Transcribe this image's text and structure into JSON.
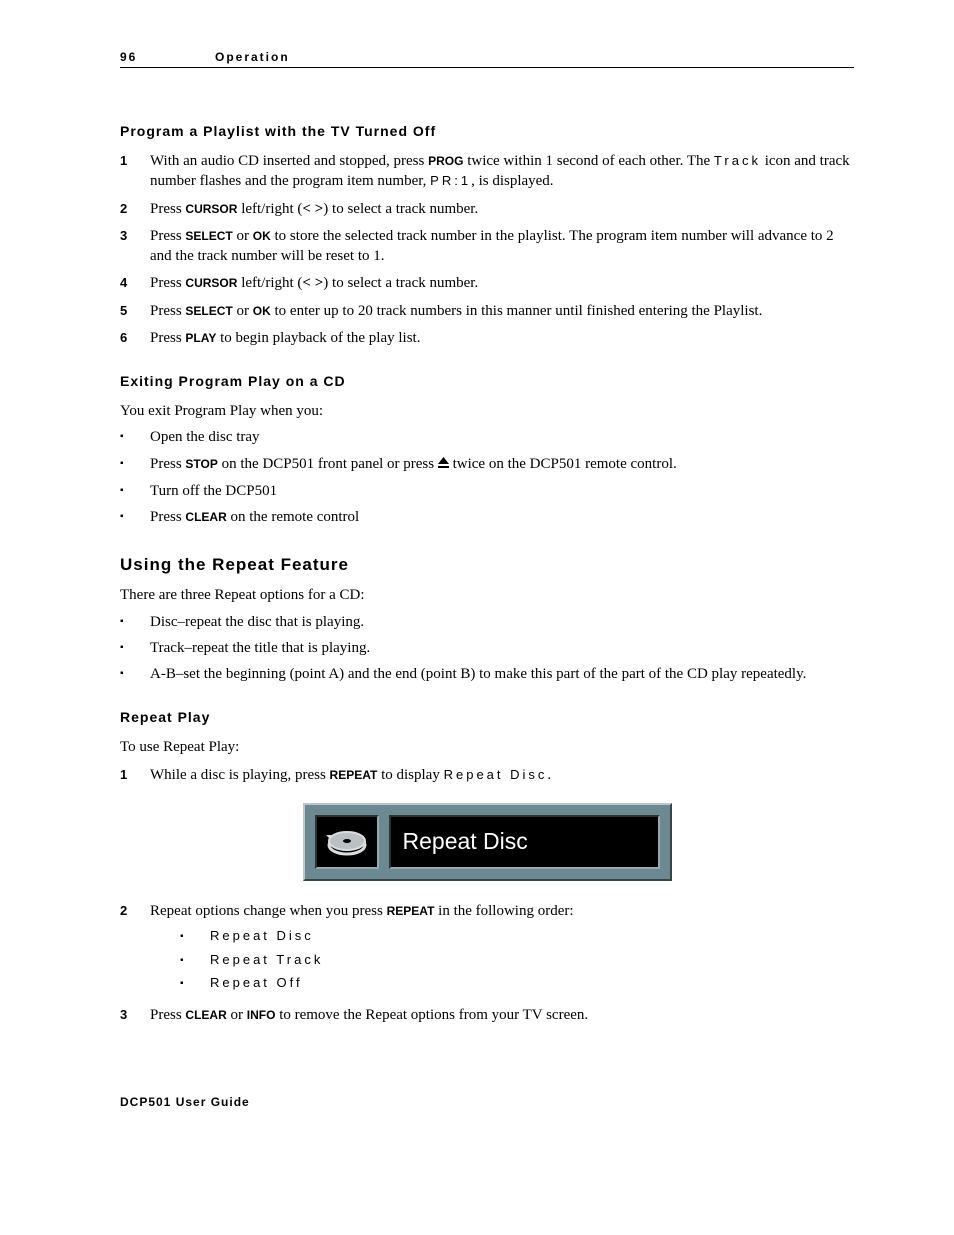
{
  "header": {
    "page": "96",
    "section": "Operation"
  },
  "h1": "Program a Playlist with the TV Turned Off",
  "steps1": {
    "n1": "1",
    "s1a": "With an audio CD inserted and stopped, press ",
    "s1b": "PROG",
    "s1c": " twice within 1 second of each other. The ",
    "s1d": "Track",
    "s1e": " icon and track number flashes and the program item number, ",
    "s1f": "PR:1",
    "s1g": ", is displayed.",
    "n2": "2",
    "s2a": "Press ",
    "s2b": "CURSOR",
    "s2c": " left/right (",
    "s2d": "< >",
    "s2e": ") to select a track number.",
    "n3": "3",
    "s3a": "Press ",
    "s3b": "SELECT",
    "s3c": " or ",
    "s3d": "OK",
    "s3e": " to store the selected track number in the playlist. The program item number will advance to 2 and the track number will be reset to 1.",
    "n4": "4",
    "s4a": "Press ",
    "s4b": "CURSOR",
    "s4c": " left/right (",
    "s4d": "< >",
    "s4e": ") to select a track number.",
    "n5": "5",
    "s5a": "Press ",
    "s5b": "SELECT",
    "s5c": " or ",
    "s5d": "OK",
    "s5e": " to enter up to 20 track numbers in this manner until finished entering the Playlist.",
    "n6": "6",
    "s6a": "Press ",
    "s6b": "PLAY",
    "s6c": " to begin playback of the play list."
  },
  "h2": "Exiting Program Play on a CD",
  "p2": "You exit Program Play when you:",
  "exit": {
    "b1": "Open the disc tray",
    "b2a": "Press ",
    "b2b": "STOP",
    "b2c": " on the DCP501 front panel or press ",
    "b2d": " twice on the DCP501 remote control.",
    "b3": "Turn off the DCP501",
    "b4a": "Press ",
    "b4b": "CLEAR",
    "b4c": " on the remote control"
  },
  "h3": "Using the Repeat Feature",
  "p3": "There are three Repeat options for a CD:",
  "repeat_opts": {
    "b1": "Disc–repeat the disc that is playing.",
    "b2": "Track–repeat the title that is playing.",
    "b3": "A-B–set the beginning (point A) and the end (point B) to make this part of the part of the CD play repeatedly."
  },
  "h4": "Repeat Play",
  "p4": "To use Repeat Play:",
  "steps2": {
    "n1": "1",
    "s1a": "While a disc is playing, press ",
    "s1b": "REPEAT",
    "s1c": " to display ",
    "s1d": "Repeat Disc",
    "s1e": ".",
    "n2": "2",
    "s2a": "Repeat options change when you press ",
    "s2b": "REPEAT",
    "s2c": " in the following order:",
    "sub1": "Repeat Disc",
    "sub2": "Repeat Track",
    "sub3": "Repeat Off",
    "n3": "3",
    "s3a": "Press ",
    "s3b": "CLEAR",
    "s3c": " or ",
    "s3d": "INFO",
    "s3e": " to remove the Repeat options from your TV screen."
  },
  "osd": {
    "label": "Repeat Disc"
  },
  "footer": "DCP501 User Guide"
}
